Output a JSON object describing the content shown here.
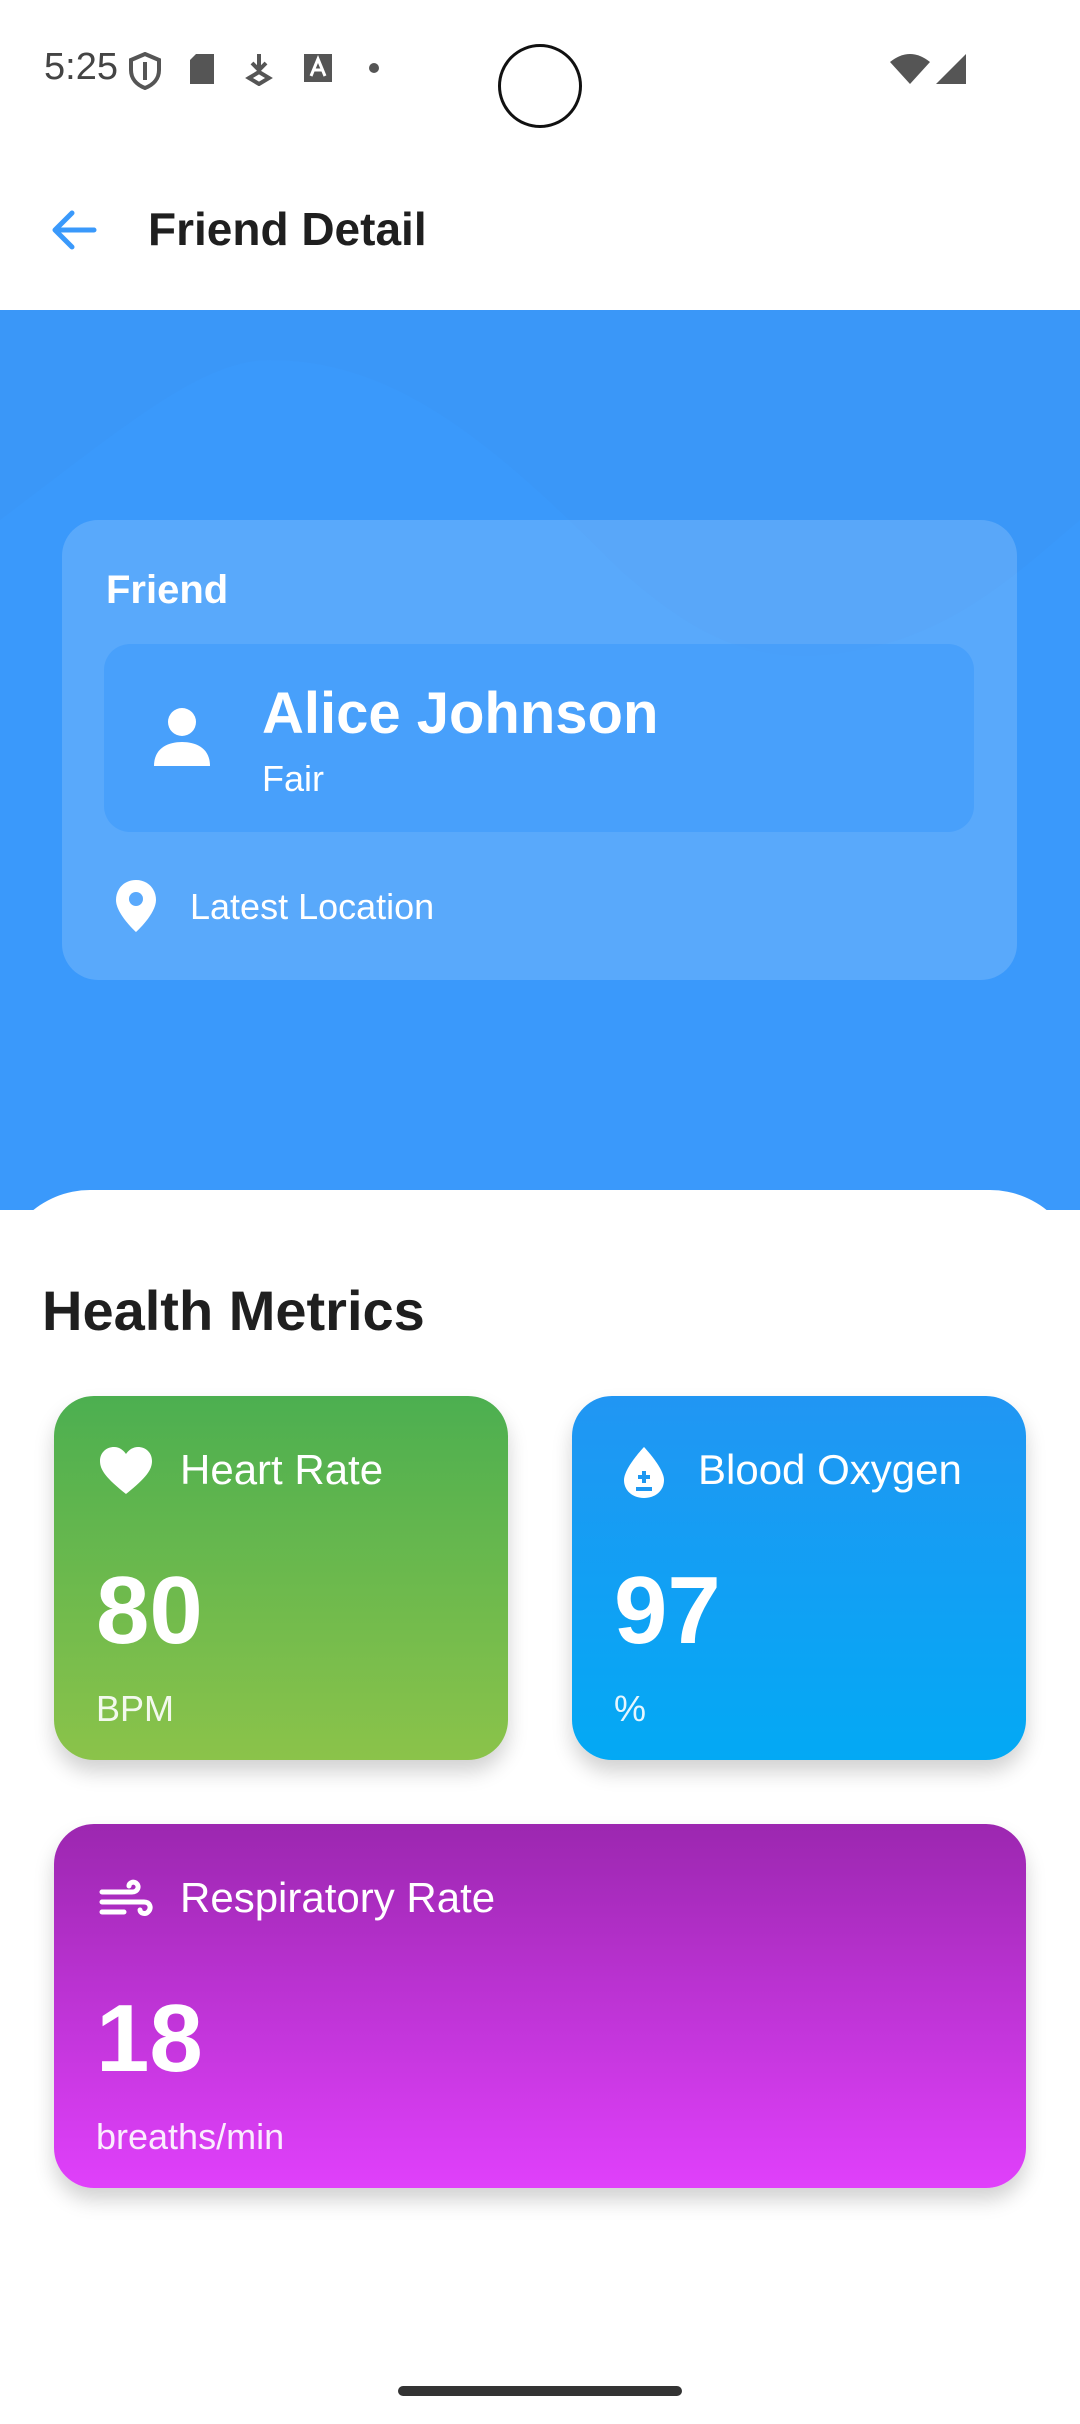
{
  "status_bar": {
    "time": "5:25"
  },
  "app_bar": {
    "title": "Friend Detail"
  },
  "friend_card": {
    "label": "Friend",
    "name": "Alice Johnson",
    "status": "Fair",
    "location_label": "Latest Location"
  },
  "health": {
    "title": "Health Metrics",
    "metrics": [
      {
        "label": "Heart Rate",
        "value": "80",
        "unit": "BPM",
        "icon": "heart-icon",
        "color_top": "#4caf50",
        "color_bottom": "#8bc34a"
      },
      {
        "label": "Blood Oxygen",
        "value": "97",
        "unit": "%",
        "icon": "blood-drop-icon",
        "color_top": "#2196f3",
        "color_bottom": "#03a9f4"
      },
      {
        "label": "Respiratory Rate",
        "value": "18",
        "unit": "breaths/min",
        "icon": "wind-icon",
        "color_top": "#9c27b0",
        "color_bottom": "#e040fb"
      }
    ]
  },
  "colors": {
    "hero": "#3a99fb",
    "accent": "#3a99fb"
  }
}
